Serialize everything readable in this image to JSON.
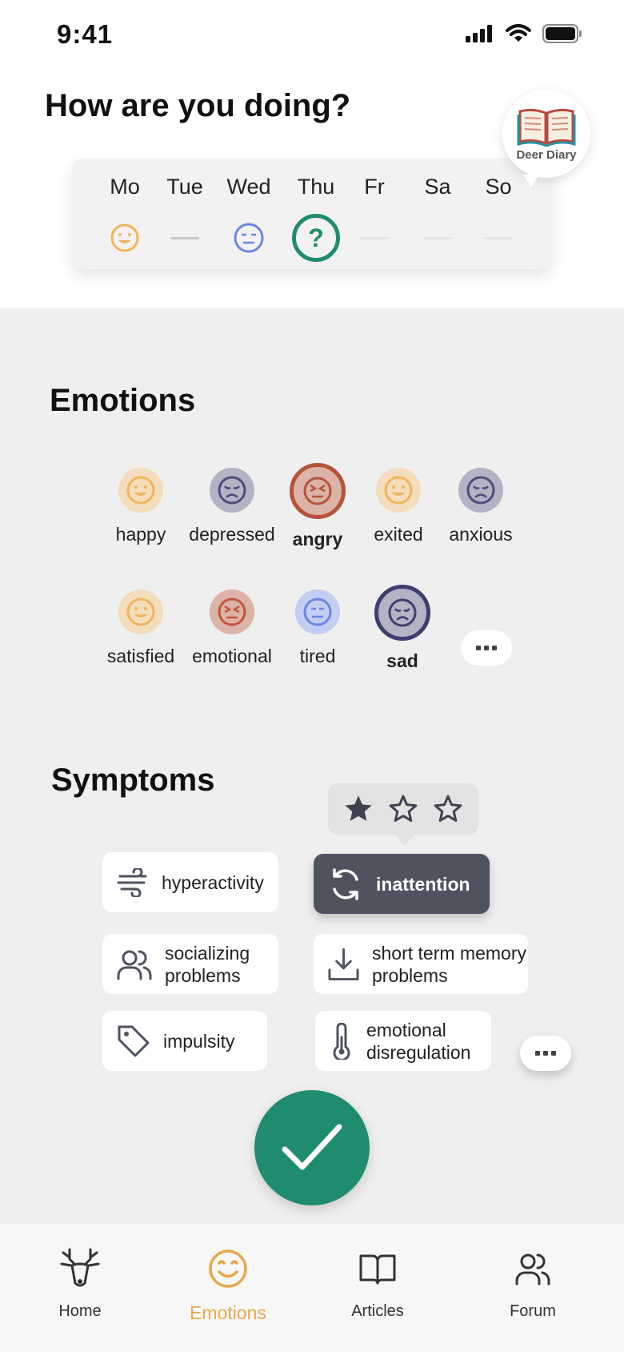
{
  "status_bar": {
    "time": "9:41"
  },
  "header": {
    "title": "How are you doing?",
    "diary_badge": "Deer Diary"
  },
  "week": {
    "days": [
      {
        "label": "Mo",
        "state": "happy"
      },
      {
        "label": "Tue",
        "state": "none"
      },
      {
        "label": "Wed",
        "state": "tired"
      },
      {
        "label": "Thu",
        "state": "today",
        "mark": "?"
      },
      {
        "label": "Fr",
        "state": "future"
      },
      {
        "label": "Sa",
        "state": "future"
      },
      {
        "label": "So",
        "state": "future"
      }
    ]
  },
  "emotions": {
    "title": "Emotions",
    "items": [
      {
        "label": "happy",
        "selected": false,
        "color": "#f0b45c"
      },
      {
        "label": "depressed",
        "selected": false,
        "color": "#4b4d7a"
      },
      {
        "label": "angry",
        "selected": true,
        "color": "#b5533a"
      },
      {
        "label": "exited",
        "selected": false,
        "color": "#f0b45c"
      },
      {
        "label": "anxious",
        "selected": false,
        "color": "#4b4d7a"
      },
      {
        "label": "satisfied",
        "selected": false,
        "color": "#f0b45c"
      },
      {
        "label": "emotional",
        "selected": false,
        "color": "#c0553d"
      },
      {
        "label": "tired",
        "selected": false,
        "color": "#6d86e0"
      },
      {
        "label": "sad",
        "selected": true,
        "color": "#3e3f6e"
      }
    ],
    "more": "more-options-icon"
  },
  "symptoms": {
    "title": "Symptoms",
    "items": [
      {
        "label": "hyperactivity",
        "icon": "wind-icon",
        "active": false
      },
      {
        "label": "inattention",
        "icon": "refresh-icon",
        "active": true
      },
      {
        "label": "socializing problems",
        "icon": "users-icon",
        "active": false
      },
      {
        "label": "short term memory problems",
        "icon": "download-icon",
        "active": false
      },
      {
        "label": "impulsity",
        "icon": "tag-icon",
        "active": false
      },
      {
        "label": "emotional disregulation",
        "icon": "thermometer-icon",
        "active": false
      }
    ],
    "rating": {
      "value": 1,
      "max": 3
    }
  },
  "confirm": {
    "icon": "checkmark-icon"
  },
  "nav": {
    "items": [
      {
        "label": "Home",
        "icon": "deer-icon",
        "active": false
      },
      {
        "label": "Emotions",
        "icon": "smile-icon",
        "active": true
      },
      {
        "label": "Articles",
        "icon": "book-icon",
        "active": false
      },
      {
        "label": "Forum",
        "icon": "users-icon",
        "active": false
      }
    ]
  },
  "colors": {
    "accent_green": "#1f8c70",
    "accent_orange": "#e9a84c",
    "active_chip": "#4f5360",
    "background_gray": "#efefef"
  }
}
